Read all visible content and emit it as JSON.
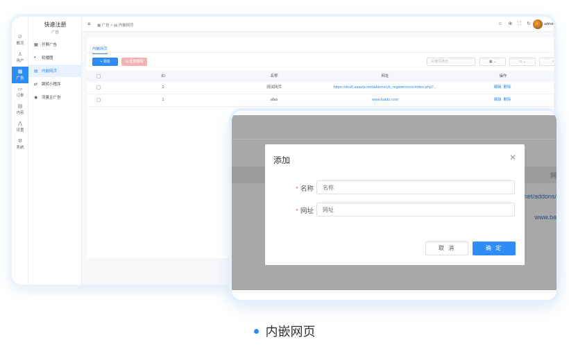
{
  "rail": {
    "items": [
      {
        "icon": "⊙",
        "label": "概况"
      },
      {
        "icon": "♙",
        "label": "用户"
      },
      {
        "icon": "▦",
        "label": "广告"
      },
      {
        "icon": "▭",
        "label": "订单"
      },
      {
        "icon": "▤",
        "label": "内容"
      },
      {
        "icon": "⋀",
        "label": "设置"
      },
      {
        "icon": "⚙",
        "label": "系统"
      }
    ]
  },
  "menu": {
    "title": "快速注册",
    "subtitle": "广告",
    "items": [
      {
        "icon": "▦",
        "label": "开屏广告"
      },
      {
        "icon": "◐",
        "label": "轮播图"
      },
      {
        "icon": "▤",
        "label": "内嵌网页"
      },
      {
        "icon": "⇄",
        "label": "跳转小程序"
      },
      {
        "icon": "◉",
        "label": "流量主广告"
      }
    ]
  },
  "topbar": {
    "breadcrumb": "▦ 广告  >  ▤ 内嵌网页",
    "icons": "☺ ⊕ ⛶ ↻",
    "user": "admin"
  },
  "panel": {
    "tab": "内嵌网页",
    "add_button": "+ 添加",
    "delete_button": "⊖ 批量删除",
    "search_placeholder": "关键词筛选",
    "filter1": "▦ ⌄",
    "filter2": "▭ ⌄",
    "filter3": "○"
  },
  "table": {
    "headers": {
      "id": "ID",
      "name": "名称",
      "url": "网址",
      "actions": "操作"
    },
    "rows": [
      {
        "id": "2",
        "name": "测试网页",
        "url": "https://dev6.saavip.net/addons/yb_register/core/index.php?...",
        "edit": "编辑",
        "delete": "删除"
      },
      {
        "id": "1",
        "name": "afas",
        "url": "www.baidu.com",
        "edit": "编辑",
        "delete": "删除"
      }
    ]
  },
  "modal_bg": {
    "header_fragment": "网",
    "url_fragment_1": "net/addons/",
    "url_fragment_2": "www.ba"
  },
  "dialog": {
    "title": "添加",
    "name_label": "名称",
    "name_placeholder": "名称",
    "url_label": "网址",
    "url_placeholder": "网址",
    "cancel": "取 消",
    "confirm": "确 定"
  },
  "caption": "内嵌网页",
  "colors": {
    "accent": "#2f8cf5",
    "danger_light": "#f6b3b3",
    "overlay": "#a8a8a8"
  }
}
